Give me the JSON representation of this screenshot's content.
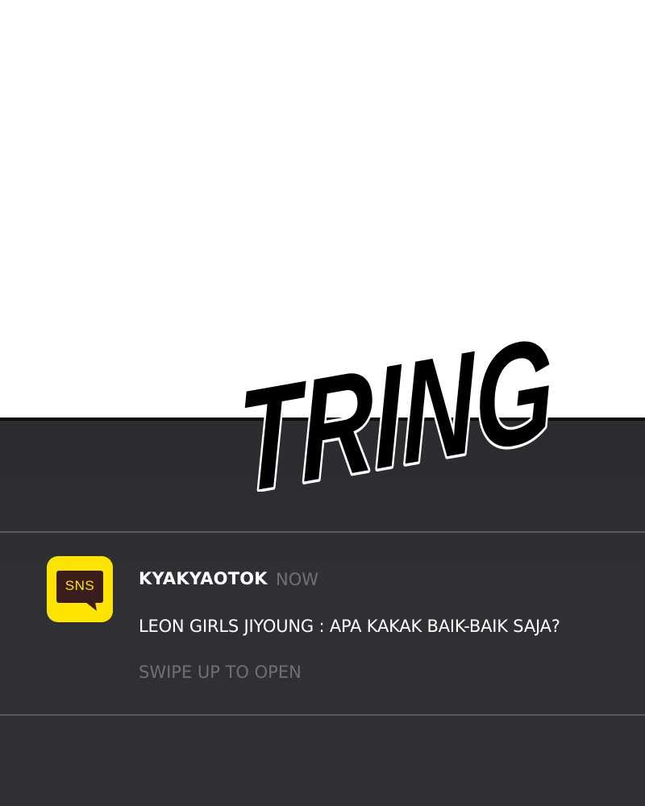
{
  "sfx": {
    "text": "TRING"
  },
  "notification": {
    "app_icon_label": "SNS",
    "app_name": "KYAKYAOTOK",
    "timestamp": "NOW",
    "message": "LEON GIRLS JIYOUNG : APA KAKAK BAIK-BAIK SAJA?",
    "hint": "SWIPE UP TO OPEN"
  },
  "colors": {
    "panel_background": "#2f3034",
    "app_icon_yellow": "#ffe300",
    "app_icon_bubble": "#3a1d1d",
    "muted_text": "#6e7075"
  }
}
